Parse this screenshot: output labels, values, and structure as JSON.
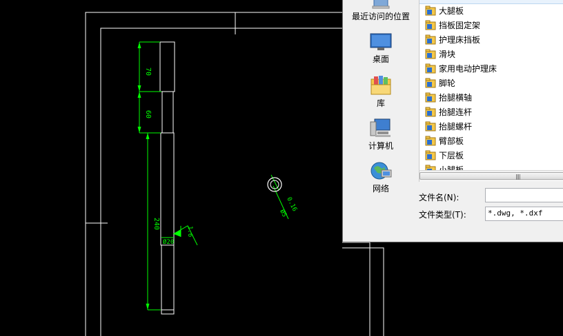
{
  "drawing": {
    "dimensions": [
      "70",
      "60",
      "240",
      "1.6",
      "Ø20"
    ],
    "callout": [
      "0.16",
      "Ø5"
    ]
  },
  "dialog": {
    "places": [
      {
        "label": "最近访问的位置",
        "icon": "recent-places-icon"
      },
      {
        "label": "桌面",
        "icon": "desktop-icon"
      },
      {
        "label": "库",
        "icon": "libraries-icon"
      },
      {
        "label": "计算机",
        "icon": "computer-icon"
      },
      {
        "label": "网络",
        "icon": "network-icon"
      }
    ],
    "files": [
      "大腿板",
      "挡板固定架",
      "护理床挡板",
      "滑块",
      "家用电动护理床",
      "脚轮",
      "抬腿横轴",
      "抬腿连杆",
      "抬腿螺杆",
      "臂部板",
      "下层板",
      "小腿板"
    ],
    "filename_label": "文件名(N):",
    "filename_value": "",
    "filetype_label": "文件类型(T):",
    "filetype_value": "*.dwg, *.dxf",
    "colors": {
      "folder": "#f4c84a",
      "cad_green": "#00ff00",
      "cad_white": "#ffffff"
    }
  }
}
